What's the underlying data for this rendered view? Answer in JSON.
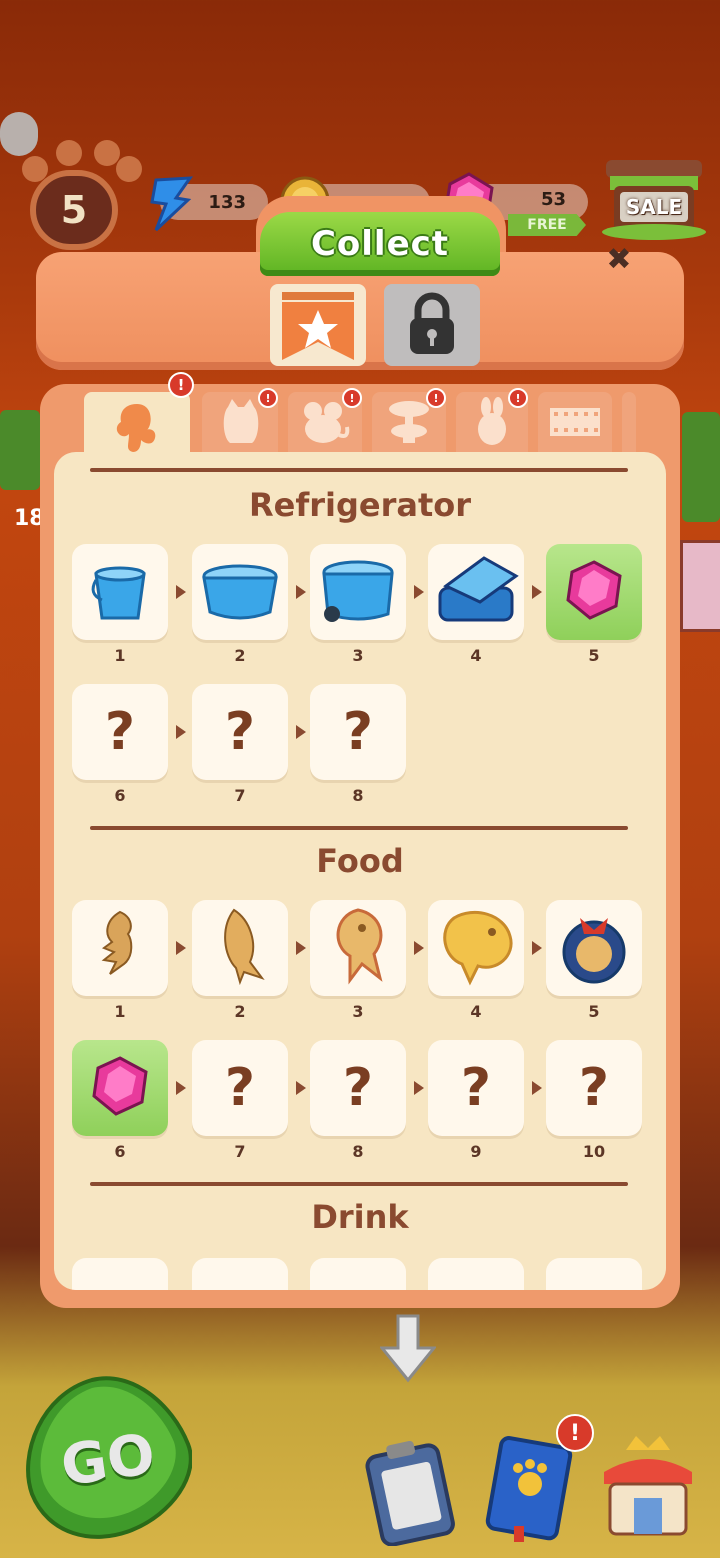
{
  "hud": {
    "level": "5",
    "energy": "133",
    "gems": "53",
    "free_label": "FREE",
    "sale_label": "SALE",
    "side_number": "18"
  },
  "dialog": {
    "title": "Collect",
    "close_label": "✖",
    "tabs": [
      "chef",
      "cat",
      "mouse",
      "cake-stand",
      "rabbit",
      "film"
    ],
    "sections": [
      {
        "title": "Refrigerator",
        "items": [
          {
            "n": "1",
            "kind": "icon",
            "icon": "blue-bucket-icon"
          },
          {
            "n": "2",
            "kind": "icon",
            "icon": "blue-pot-icon"
          },
          {
            "n": "3",
            "kind": "icon",
            "icon": "blue-cooler-icon"
          },
          {
            "n": "4",
            "kind": "icon",
            "icon": "blue-lunchbox-icon"
          },
          {
            "n": "5",
            "kind": "gem",
            "icon": "pink-gem-icon"
          },
          {
            "n": "6",
            "kind": "unknown",
            "label": "?"
          },
          {
            "n": "7",
            "kind": "unknown",
            "label": "?"
          },
          {
            "n": "8",
            "kind": "unknown",
            "label": "?"
          }
        ]
      },
      {
        "title": "Food",
        "items": [
          {
            "n": "1",
            "kind": "icon",
            "icon": "fish-bone-cookie-icon"
          },
          {
            "n": "2",
            "kind": "icon",
            "icon": "fish-cookie-icon"
          },
          {
            "n": "3",
            "kind": "icon",
            "icon": "taiyaki-icon"
          },
          {
            "n": "4",
            "kind": "icon",
            "icon": "big-taiyaki-icon"
          },
          {
            "n": "5",
            "kind": "icon",
            "icon": "gift-bag-icon"
          },
          {
            "n": "6",
            "kind": "gem",
            "icon": "pink-gem-icon"
          },
          {
            "n": "7",
            "kind": "unknown",
            "label": "?"
          },
          {
            "n": "8",
            "kind": "unknown",
            "label": "?"
          },
          {
            "n": "9",
            "kind": "unknown",
            "label": "?"
          },
          {
            "n": "10",
            "kind": "unknown",
            "label": "?"
          }
        ]
      },
      {
        "title": "Drink",
        "items": []
      }
    ]
  },
  "bottom": {
    "go_label": "GO"
  },
  "colors": {
    "accent_green": "#5db322",
    "panel_orange": "#ef9a6c",
    "panel_cream": "#f7e6c3",
    "text_brown": "#8a4a30",
    "alert_red": "#d83a2a",
    "gem_pink": "#e83a9c"
  }
}
